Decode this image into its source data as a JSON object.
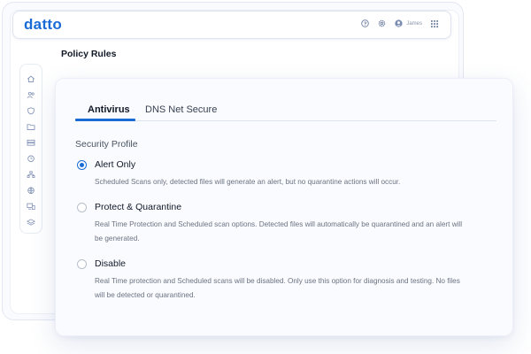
{
  "brand": {
    "logo_text": "datto",
    "accent_color": "#1a6bd6"
  },
  "topbar": {
    "icons": [
      "help-icon",
      "settings-icon",
      "user-icon",
      "apps-grid-icon"
    ],
    "user_name": "James"
  },
  "page": {
    "title": "Policy Rules"
  },
  "sidebar": {
    "icons": [
      "home-icon",
      "users-icon",
      "shield-icon",
      "folder-icon",
      "server-icon",
      "clock-icon",
      "network-icon",
      "globe-icon",
      "devices-icon",
      "layers-icon"
    ]
  },
  "tabs": [
    {
      "label": "Antivirus",
      "active": true
    },
    {
      "label": "DNS Net Secure",
      "active": false
    }
  ],
  "security_profile": {
    "label": "Security Profile",
    "selected": "Alert Only",
    "options": [
      {
        "label": "Alert Only",
        "checked": true,
        "description": "Scheduled Scans only, detected files will generate an alert, but no quarantine actions will occur."
      },
      {
        "label": "Protect & Quarantine",
        "checked": false,
        "description": "Real Time Protection and Scheduled scan options. Detected files will automatically be quarantined and an alert will be generated."
      },
      {
        "label": "Disable",
        "checked": false,
        "description": "Real Time protection and Scheduled scans will be disabled. Only use this option for diagnosis and testing. No files will be detected or quarantined."
      }
    ]
  }
}
